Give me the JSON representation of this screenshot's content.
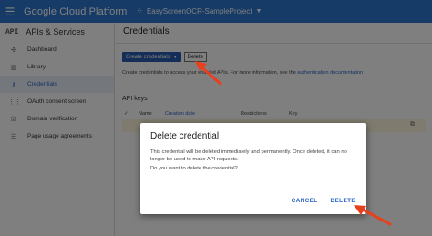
{
  "header": {
    "brand": "Google Cloud Platform",
    "project_name": "EasyScreenOCR-SampleProject",
    "bar_color": "#2f77ce"
  },
  "sidebar": {
    "api_tag": "API",
    "title": "APIs & Services",
    "items": [
      {
        "label": "Dashboard",
        "icon": "dashboard-icon"
      },
      {
        "label": "Library",
        "icon": "library-icon"
      },
      {
        "label": "Credentials",
        "icon": "key-icon",
        "active": true
      },
      {
        "label": "OAuth consent screen",
        "icon": "consent-icon"
      },
      {
        "label": "Domain verification",
        "icon": "checkbox-icon"
      },
      {
        "label": "Page usage agreements",
        "icon": "settings-list-icon"
      }
    ]
  },
  "main": {
    "title": "Credentials",
    "create_button": "Create credentials",
    "delete_button": "Delete",
    "info_prefix": "Create credentials to access your enabled APIs. For more information, see the",
    "info_link": "authentication documentation",
    "section_title": "API keys",
    "table_headers": [
      "Name",
      "Creation date",
      "Restrictions",
      "Key"
    ]
  },
  "dialog": {
    "title": "Delete credential",
    "body": "This credential will be deleted immediately and permanently. Once deleted, it can no longer be used to make API requests.",
    "question": "Do you want to delete the credential?",
    "cancel": "CANCEL",
    "delete": "DELETE"
  },
  "colors": {
    "accent": "#2a66c4",
    "primary_button": "#2a5db0",
    "annotation_arrow": "#e8401c"
  }
}
